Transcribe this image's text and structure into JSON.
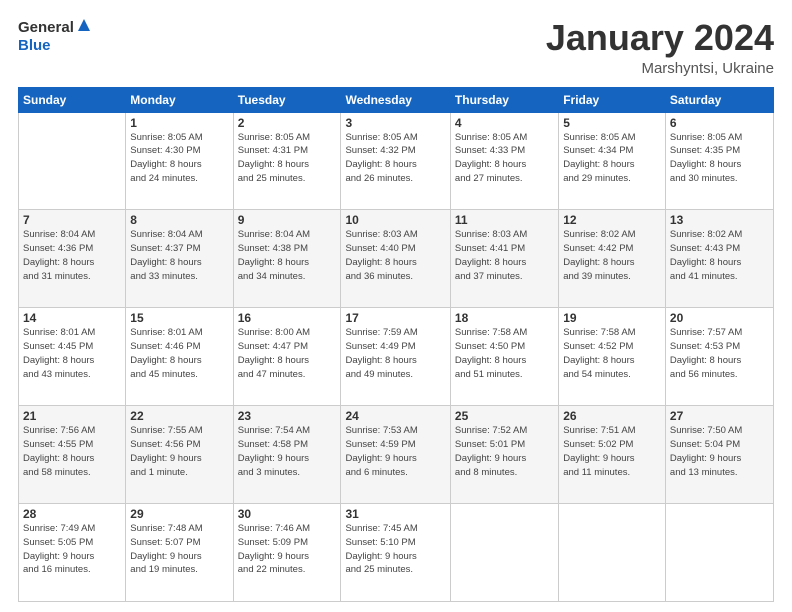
{
  "header": {
    "logo_general": "General",
    "logo_blue": "Blue",
    "title": "January 2024",
    "location": "Marshyntsi, Ukraine"
  },
  "days_of_week": [
    "Sunday",
    "Monday",
    "Tuesday",
    "Wednesday",
    "Thursday",
    "Friday",
    "Saturday"
  ],
  "weeks": [
    [
      {
        "day": "",
        "info": ""
      },
      {
        "day": "1",
        "info": "Sunrise: 8:05 AM\nSunset: 4:30 PM\nDaylight: 8 hours\nand 24 minutes."
      },
      {
        "day": "2",
        "info": "Sunrise: 8:05 AM\nSunset: 4:31 PM\nDaylight: 8 hours\nand 25 minutes."
      },
      {
        "day": "3",
        "info": "Sunrise: 8:05 AM\nSunset: 4:32 PM\nDaylight: 8 hours\nand 26 minutes."
      },
      {
        "day": "4",
        "info": "Sunrise: 8:05 AM\nSunset: 4:33 PM\nDaylight: 8 hours\nand 27 minutes."
      },
      {
        "day": "5",
        "info": "Sunrise: 8:05 AM\nSunset: 4:34 PM\nDaylight: 8 hours\nand 29 minutes."
      },
      {
        "day": "6",
        "info": "Sunrise: 8:05 AM\nSunset: 4:35 PM\nDaylight: 8 hours\nand 30 minutes."
      }
    ],
    [
      {
        "day": "7",
        "info": "Sunrise: 8:04 AM\nSunset: 4:36 PM\nDaylight: 8 hours\nand 31 minutes."
      },
      {
        "day": "8",
        "info": "Sunrise: 8:04 AM\nSunset: 4:37 PM\nDaylight: 8 hours\nand 33 minutes."
      },
      {
        "day": "9",
        "info": "Sunrise: 8:04 AM\nSunset: 4:38 PM\nDaylight: 8 hours\nand 34 minutes."
      },
      {
        "day": "10",
        "info": "Sunrise: 8:03 AM\nSunset: 4:40 PM\nDaylight: 8 hours\nand 36 minutes."
      },
      {
        "day": "11",
        "info": "Sunrise: 8:03 AM\nSunset: 4:41 PM\nDaylight: 8 hours\nand 37 minutes."
      },
      {
        "day": "12",
        "info": "Sunrise: 8:02 AM\nSunset: 4:42 PM\nDaylight: 8 hours\nand 39 minutes."
      },
      {
        "day": "13",
        "info": "Sunrise: 8:02 AM\nSunset: 4:43 PM\nDaylight: 8 hours\nand 41 minutes."
      }
    ],
    [
      {
        "day": "14",
        "info": "Sunrise: 8:01 AM\nSunset: 4:45 PM\nDaylight: 8 hours\nand 43 minutes."
      },
      {
        "day": "15",
        "info": "Sunrise: 8:01 AM\nSunset: 4:46 PM\nDaylight: 8 hours\nand 45 minutes."
      },
      {
        "day": "16",
        "info": "Sunrise: 8:00 AM\nSunset: 4:47 PM\nDaylight: 8 hours\nand 47 minutes."
      },
      {
        "day": "17",
        "info": "Sunrise: 7:59 AM\nSunset: 4:49 PM\nDaylight: 8 hours\nand 49 minutes."
      },
      {
        "day": "18",
        "info": "Sunrise: 7:58 AM\nSunset: 4:50 PM\nDaylight: 8 hours\nand 51 minutes."
      },
      {
        "day": "19",
        "info": "Sunrise: 7:58 AM\nSunset: 4:52 PM\nDaylight: 8 hours\nand 54 minutes."
      },
      {
        "day": "20",
        "info": "Sunrise: 7:57 AM\nSunset: 4:53 PM\nDaylight: 8 hours\nand 56 minutes."
      }
    ],
    [
      {
        "day": "21",
        "info": "Sunrise: 7:56 AM\nSunset: 4:55 PM\nDaylight: 8 hours\nand 58 minutes."
      },
      {
        "day": "22",
        "info": "Sunrise: 7:55 AM\nSunset: 4:56 PM\nDaylight: 9 hours\nand 1 minute."
      },
      {
        "day": "23",
        "info": "Sunrise: 7:54 AM\nSunset: 4:58 PM\nDaylight: 9 hours\nand 3 minutes."
      },
      {
        "day": "24",
        "info": "Sunrise: 7:53 AM\nSunset: 4:59 PM\nDaylight: 9 hours\nand 6 minutes."
      },
      {
        "day": "25",
        "info": "Sunrise: 7:52 AM\nSunset: 5:01 PM\nDaylight: 9 hours\nand 8 minutes."
      },
      {
        "day": "26",
        "info": "Sunrise: 7:51 AM\nSunset: 5:02 PM\nDaylight: 9 hours\nand 11 minutes."
      },
      {
        "day": "27",
        "info": "Sunrise: 7:50 AM\nSunset: 5:04 PM\nDaylight: 9 hours\nand 13 minutes."
      }
    ],
    [
      {
        "day": "28",
        "info": "Sunrise: 7:49 AM\nSunset: 5:05 PM\nDaylight: 9 hours\nand 16 minutes."
      },
      {
        "day": "29",
        "info": "Sunrise: 7:48 AM\nSunset: 5:07 PM\nDaylight: 9 hours\nand 19 minutes."
      },
      {
        "day": "30",
        "info": "Sunrise: 7:46 AM\nSunset: 5:09 PM\nDaylight: 9 hours\nand 22 minutes."
      },
      {
        "day": "31",
        "info": "Sunrise: 7:45 AM\nSunset: 5:10 PM\nDaylight: 9 hours\nand 25 minutes."
      },
      {
        "day": "",
        "info": ""
      },
      {
        "day": "",
        "info": ""
      },
      {
        "day": "",
        "info": ""
      }
    ]
  ]
}
